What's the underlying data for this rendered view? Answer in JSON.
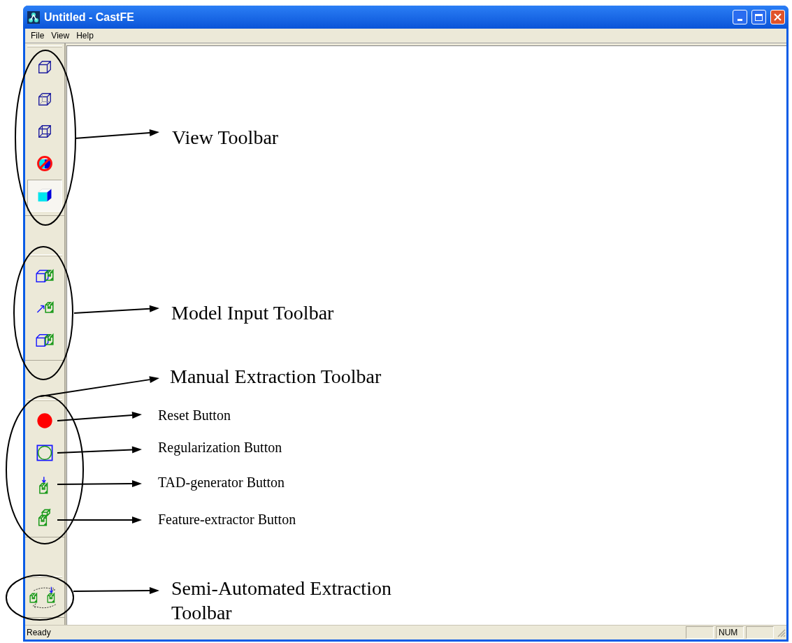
{
  "window": {
    "title": "Untitled - CastFE"
  },
  "menu": [
    "File",
    "View",
    "Help"
  ],
  "toolbars": [
    {
      "buttons": [
        {
          "kind": "cube",
          "selected": false
        },
        {
          "kind": "cube-hidden",
          "selected": false
        },
        {
          "kind": "wireframe",
          "selected": false
        },
        {
          "kind": "no-shade",
          "selected": false
        },
        {
          "kind": "shaded",
          "selected": true
        }
      ]
    },
    {
      "buttons": [
        {
          "kind": "solid-part",
          "selected": false
        },
        {
          "kind": "arrow-part",
          "selected": false
        },
        {
          "kind": "linked-part",
          "selected": false
        }
      ]
    },
    {
      "buttons": [
        {
          "kind": "reset",
          "selected": false
        },
        {
          "kind": "regularize",
          "selected": false
        },
        {
          "kind": "tad",
          "selected": false
        },
        {
          "kind": "feature",
          "selected": false
        }
      ]
    },
    {
      "buttons": [
        {
          "kind": "semi-auto",
          "selected": false
        }
      ]
    }
  ],
  "annotations": [
    {
      "text": "View Toolbar",
      "kind": "group"
    },
    {
      "text": "Model Input Toolbar",
      "kind": "group"
    },
    {
      "text": "Manual Extraction Toolbar",
      "kind": "group"
    },
    {
      "text": "Reset Button",
      "kind": "button"
    },
    {
      "text": "Regularization Button",
      "kind": "button"
    },
    {
      "text": "TAD-generator Button",
      "kind": "button"
    },
    {
      "text": "Feature-extractor Button",
      "kind": "button"
    },
    {
      "text": "Semi-Automated Extraction Toolbar",
      "kind": "group"
    }
  ],
  "status_bar": {
    "text": "Ready",
    "indicators": [
      "NUM"
    ]
  }
}
